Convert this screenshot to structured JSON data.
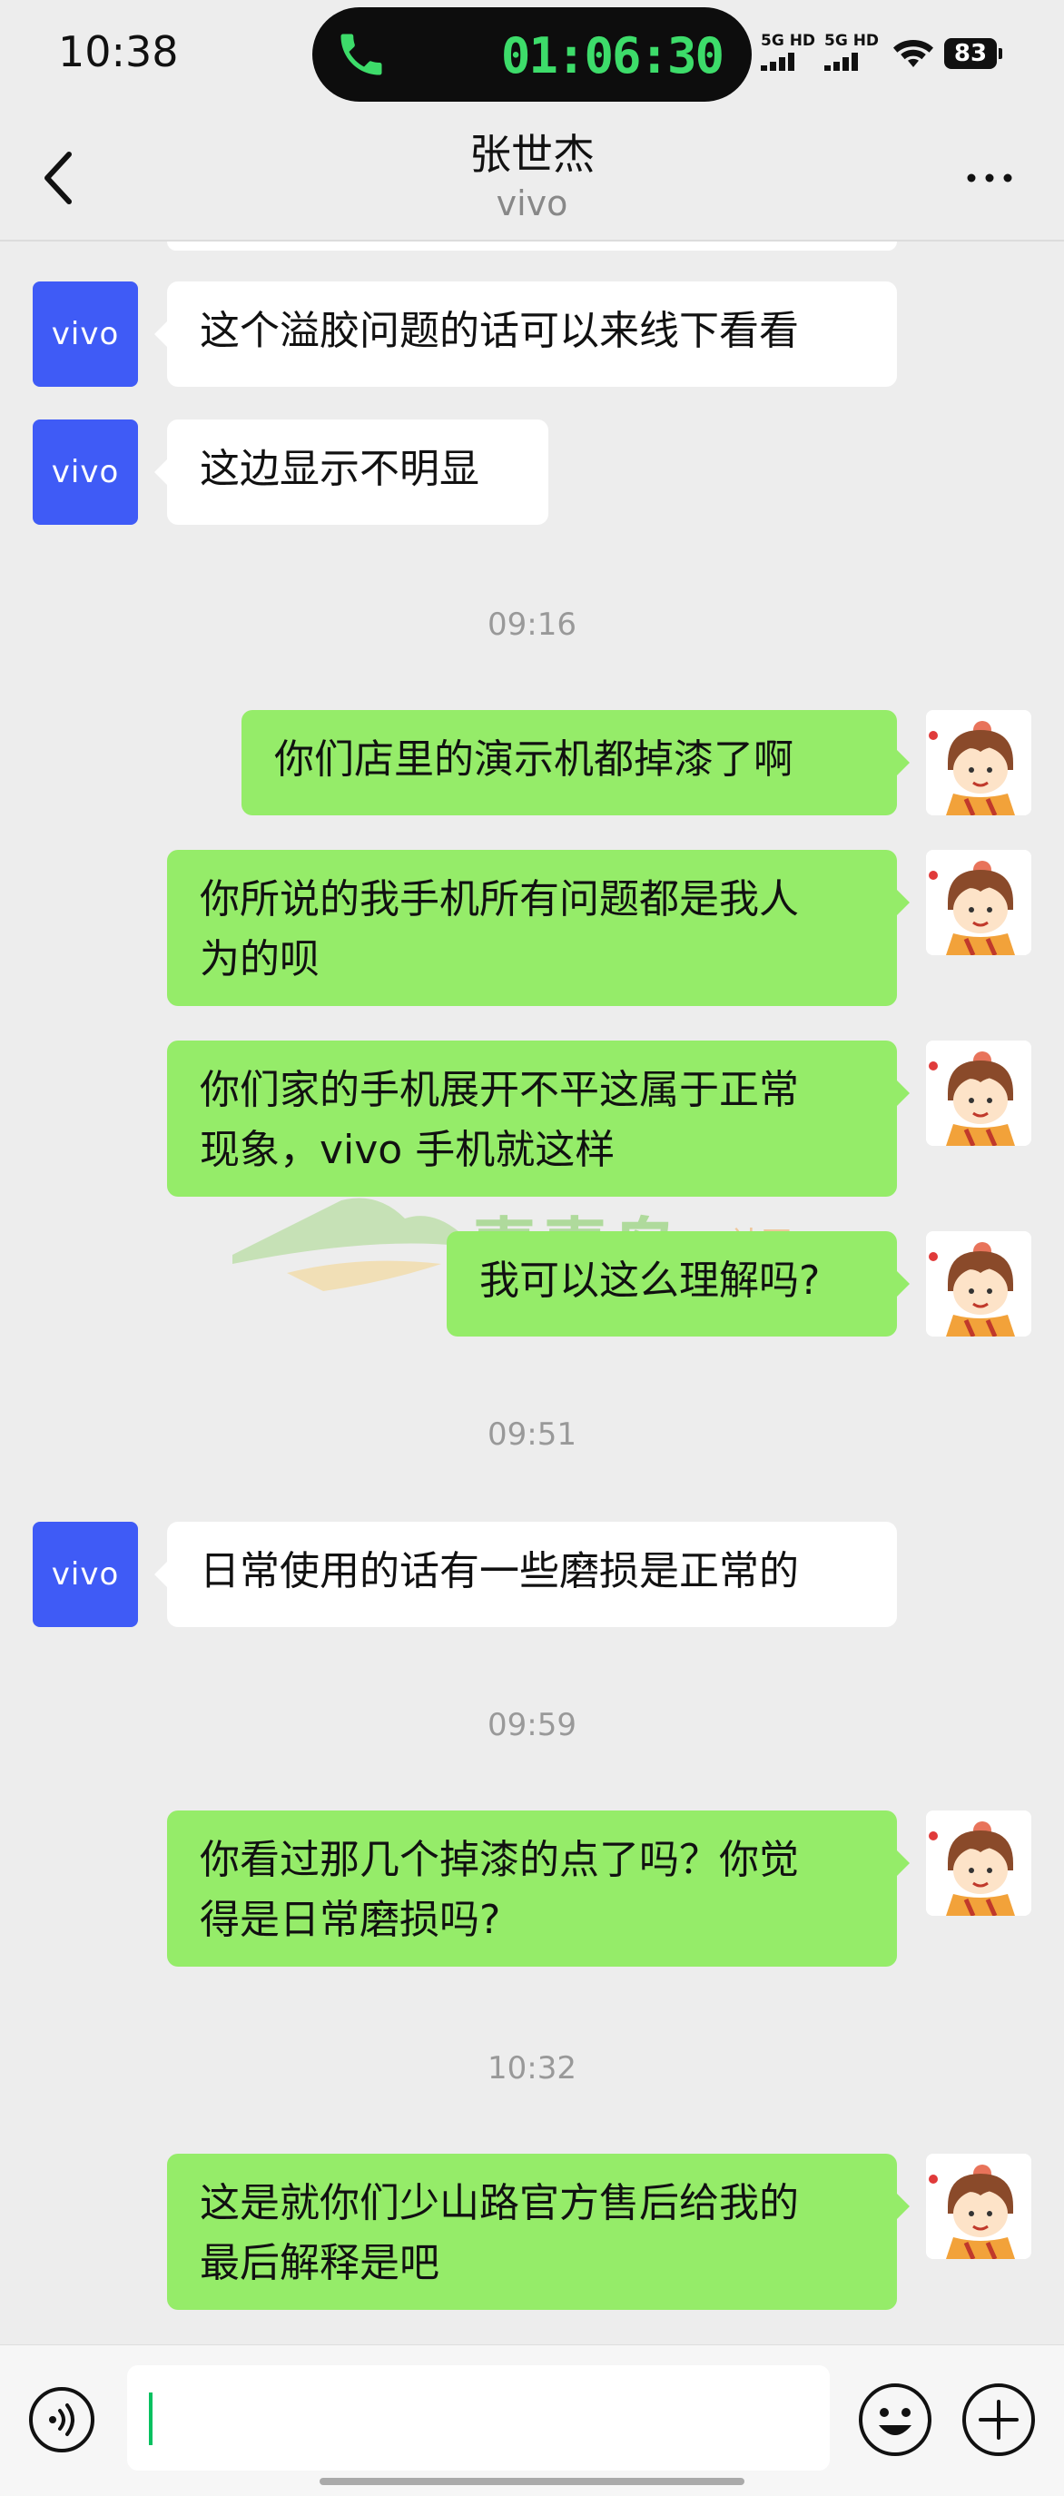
{
  "status_bar": {
    "time": "10:38",
    "call_timer": "01:06:30",
    "sim1_label": "5G HD",
    "sim2_label": "5G HD",
    "battery": "83"
  },
  "header": {
    "title": "张世杰",
    "subtitle": "vivo"
  },
  "contact_avatar_label": "vivo",
  "messages": [
    {
      "side": "in",
      "text": "这个溢胶问题的话可以来线下看看"
    },
    {
      "side": "in",
      "text": "这边显示不明显"
    },
    {
      "side": "time",
      "text": "09:16"
    },
    {
      "side": "out",
      "text": "你们店里的演示机都掉漆了啊"
    },
    {
      "side": "out",
      "text": "你所说的我手机所有问题都是我人\n为的呗"
    },
    {
      "side": "out",
      "text": "你们家的手机展开不平这属于正常\n现象，vivo 手机就这样"
    },
    {
      "side": "out",
      "text": "我可以这么理解吗?"
    },
    {
      "side": "time",
      "text": "09:51"
    },
    {
      "side": "in",
      "text": "日常使用的话有一些磨损是正常的"
    },
    {
      "side": "time",
      "text": "09:59"
    },
    {
      "side": "out",
      "text": "你看过那几个掉漆的点了吗？你觉\n得是日常磨损吗?"
    },
    {
      "side": "time",
      "text": "10:32"
    },
    {
      "side": "out",
      "text": "这是就你们少山路官方售后给我的\n最后解释是吧"
    }
  ],
  "watermark": {
    "main": "青青岛",
    "small": "社区"
  },
  "input": {
    "value": ""
  },
  "colors": {
    "out_bubble": "#95ec69",
    "in_bubble": "#ffffff",
    "vivo_blue": "#3f5bf6",
    "background": "#ededed"
  }
}
